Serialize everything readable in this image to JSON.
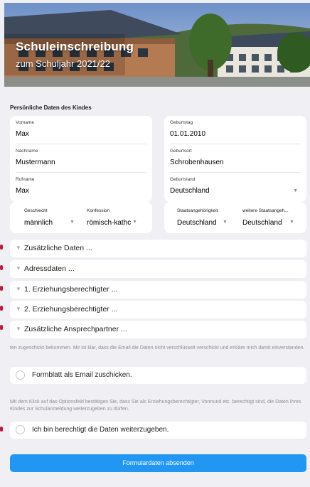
{
  "header": {
    "title": "Schuleinschreibung",
    "subtitle": "zum Schuljahr 2021/22"
  },
  "section_title": "Persönliche Daten des Kindes",
  "left_fields": [
    {
      "label": "Vorname",
      "value": "Max"
    },
    {
      "label": "Nachname",
      "value": "Mustermann"
    },
    {
      "label": "Rufname",
      "value": "Max"
    }
  ],
  "right_fields": [
    {
      "label": "Geburtstag",
      "value": "01.01.2010"
    },
    {
      "label": "Geburtsort",
      "value": "Schrobenhausen"
    },
    {
      "label": "Geburtsland",
      "value": "Deutschland"
    }
  ],
  "selects_left": [
    {
      "label": "Geschlecht",
      "value": "männlich"
    },
    {
      "label": "Konfession",
      "value": "römisch-kathc"
    }
  ],
  "selects_right": [
    {
      "label": "Staatsangehörigkeit",
      "value": "Deutschland"
    },
    {
      "label": "weitere Staatsangeh...",
      "value": "Deutschland"
    }
  ],
  "accordion": [
    {
      "label": "Zusätzliche Daten ..."
    },
    {
      "label": "Adressdaten ..."
    },
    {
      "label": "1. Erziehungsberechtigter ..."
    },
    {
      "label": "2. Erziehungsberechtigter ..."
    },
    {
      "label": "Zusätzliche Ansprechpartner ..."
    }
  ],
  "notes": {
    "email_note": "ten zugeschickt bekommen. Mir ist klar, dass die Email die Daten nicht verschlüsselt verschickt und erkläre mich damit einverstanden.",
    "consent_note": "Mit dem Klick auf das Optionsfeld bestätigen Sie, dass Sie als Erziehungsberechtigter, Vormund etc. berechtigt sind, die Daten Ihres Kindes zur Schulanmeldung weiterzugeben zu dürfen."
  },
  "options": {
    "email_option": "Formblatt als Email zuschicken.",
    "consent_option": "Ich bin berechtigt die Daten weiterzugeben."
  },
  "submit_label": "Formulardaten absenden",
  "colors": {
    "accent": "#2196f3",
    "marker": "#c0183c",
    "background": "#efeff4"
  }
}
